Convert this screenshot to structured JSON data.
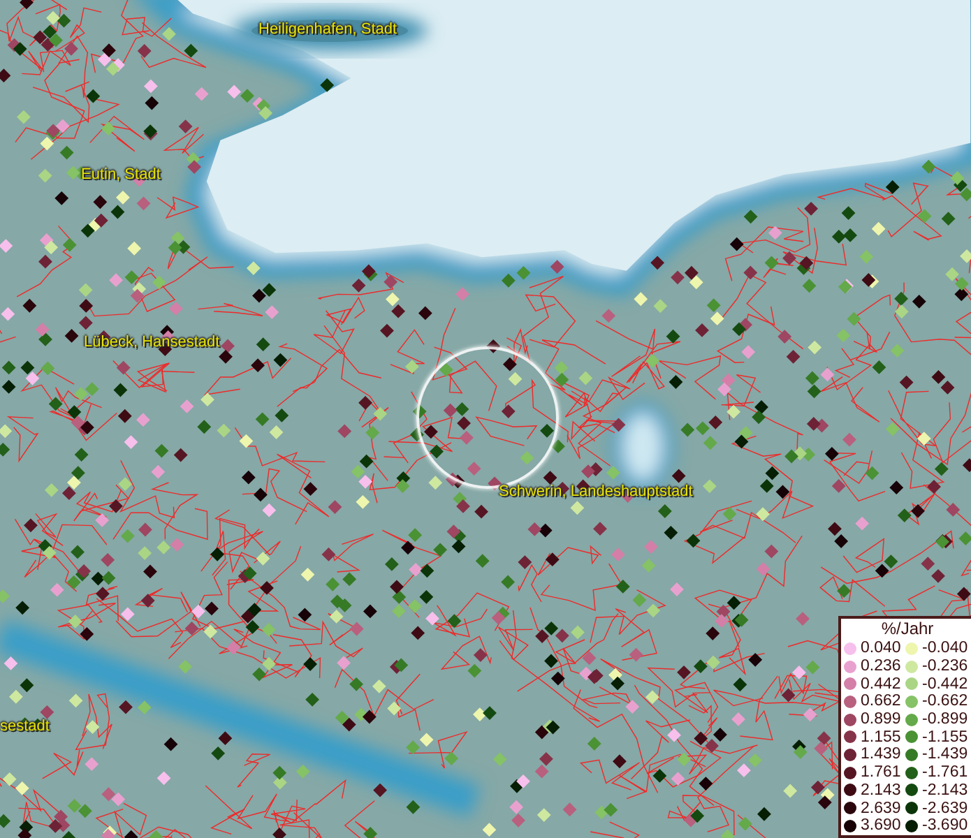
{
  "map": {
    "places": [
      {
        "name": "Heiligenhafen, Stadt"
      },
      {
        "name": "Eutin, Stadt"
      },
      {
        "name": "Lübeck, Hansestadt"
      },
      {
        "name": "Schwerin, Landeshauptstadt"
      },
      {
        "name": "sestadt"
      }
    ]
  },
  "legend": {
    "title": "%/Jahr",
    "entries": [
      {
        "label": "0.040",
        "color": "#f7bfec"
      },
      {
        "label": "-0.040",
        "color": "#eef5ad"
      },
      {
        "label": "0.236",
        "color": "#e8a1cf"
      },
      {
        "label": "-0.236",
        "color": "#cfe8a0"
      },
      {
        "label": "0.442",
        "color": "#d47fa8"
      },
      {
        "label": "-0.442",
        "color": "#aad584"
      },
      {
        "label": "0.662",
        "color": "#b8607e"
      },
      {
        "label": "-0.662",
        "color": "#86c266"
      },
      {
        "label": "0.899",
        "color": "#9e4662"
      },
      {
        "label": "-0.899",
        "color": "#64a94a"
      },
      {
        "label": "1.155",
        "color": "#86334a"
      },
      {
        "label": "-1.155",
        "color": "#4a9234"
      },
      {
        "label": "1.439",
        "color": "#6e2236"
      },
      {
        "label": "-1.439",
        "color": "#367a26"
      },
      {
        "label": "1.761",
        "color": "#561522"
      },
      {
        "label": "-1.761",
        "color": "#236019"
      },
      {
        "label": "2.143",
        "color": "#3e0b14"
      },
      {
        "label": "-2.143",
        "color": "#144a10"
      },
      {
        "label": "2.639",
        "color": "#2a050c"
      },
      {
        "label": "-2.639",
        "color": "#0b3508"
      },
      {
        "label": "3.690",
        "color": "#160207"
      },
      {
        "label": "-3.690",
        "color": "#051e04"
      }
    ]
  }
}
